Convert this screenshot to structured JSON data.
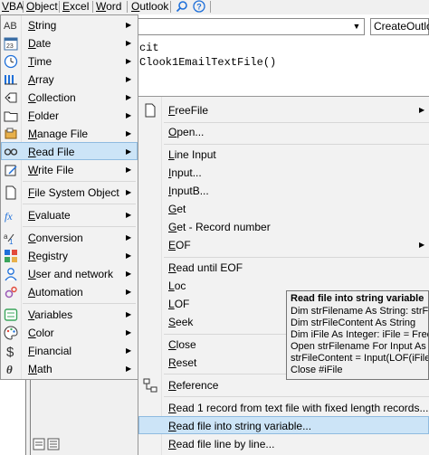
{
  "menubar": {
    "items": [
      {
        "label": "VBA",
        "accel": "V",
        "rest": "BA"
      },
      {
        "label": "Object",
        "accel": "O",
        "rest": "bject"
      },
      {
        "label": "Excel",
        "accel": "E",
        "rest": "xcel"
      },
      {
        "label": "Word",
        "accel": "W",
        "rest": "ord"
      },
      {
        "label": "Outlook",
        "accel": "O",
        "rest": "utlook"
      }
    ]
  },
  "editor": {
    "procedure_combo": "CreateOutlo",
    "code_line_1": "cit",
    "code_line_2": "Clook1EmailTextFile()"
  },
  "main_menu": {
    "items": [
      {
        "icon": "text-ab-icon",
        "accel": "S",
        "rest": "tring"
      },
      {
        "icon": "calendar-icon",
        "accel": "D",
        "rest": "ate"
      },
      {
        "icon": "clock-icon",
        "accel": "T",
        "rest": "ime"
      },
      {
        "icon": "array-icon",
        "accel": "A",
        "rest": "rray"
      },
      {
        "icon": "collection-icon",
        "accel": "C",
        "rest": "ollection"
      },
      {
        "icon": "folder-icon",
        "accel": "F",
        "rest": "older"
      },
      {
        "icon": "manage-file-icon",
        "accel": "M",
        "rest": "anage File"
      },
      {
        "icon": "glasses-icon",
        "accel": "R",
        "rest": "ead File"
      },
      {
        "icon": "write-file-icon",
        "accel": "W",
        "rest": "rite File"
      },
      {
        "icon": "document-icon",
        "accel": "F",
        "rest": "ile System Object"
      },
      {
        "icon": "fx-icon",
        "accel": "E",
        "rest": "valuate"
      },
      {
        "icon": "conversion-icon",
        "accel": "C",
        "rest": "onversion"
      },
      {
        "icon": "registry-icon",
        "accel": "R",
        "rest": "egistry"
      },
      {
        "icon": "user-icon",
        "accel": "U",
        "rest": "ser and network"
      },
      {
        "icon": "automation-icon",
        "accel": "A",
        "rest": "utomation"
      },
      {
        "icon": "variables-icon",
        "accel": "V",
        "rest": "ariables"
      },
      {
        "icon": "palette-icon",
        "accel": "C",
        "rest": "olor"
      },
      {
        "icon": "dollar-icon",
        "accel": "F",
        "rest": "inancial"
      },
      {
        "icon": "theta-icon",
        "accel": "M",
        "rest": "ath"
      }
    ]
  },
  "sub_menu": {
    "items": [
      {
        "accel": "F",
        "rest": "reeFile"
      },
      {
        "accel": "O",
        "rest": "pen..."
      },
      {
        "accel": "L",
        "rest": "ine Input"
      },
      {
        "accel": "I",
        "rest": "nput..."
      },
      {
        "accel": "I",
        "rest": "nputB..."
      },
      {
        "accel": "G",
        "rest": "et"
      },
      {
        "accel": "G",
        "rest": "et - Record number"
      },
      {
        "accel": "E",
        "rest": "OF"
      },
      {
        "accel": "R",
        "rest": "ead until EOF"
      },
      {
        "accel": "L",
        "rest": "oc"
      },
      {
        "accel": "L",
        "rest": "OF"
      },
      {
        "accel": "S",
        "rest": "eek"
      },
      {
        "accel": "C",
        "rest": "lose"
      },
      {
        "accel": "R",
        "rest": "eset"
      },
      {
        "accel": "R",
        "rest": "eference"
      },
      {
        "accel": "R",
        "rest": "ead 1 record from text file with fixed length records..."
      },
      {
        "accel": "R",
        "rest": "ead file into string variable..."
      },
      {
        "accel": "R",
        "rest": "ead file line by line..."
      }
    ]
  },
  "tooltip": {
    "title": "Read file into string variable",
    "lines": [
      "Dim strFilename As String: strFil",
      "Dim strFileContent As String",
      "Dim iFile As Integer: iFile = FreeF",
      "Open strFilename For Input As #",
      "strFileContent = Input(LOF(iFile)",
      "Close #iFile"
    ]
  },
  "colors": {
    "highlight": "#cce4f7",
    "menu_bg": "#f2f2f2",
    "accent_blue": "#1e6fd9"
  }
}
